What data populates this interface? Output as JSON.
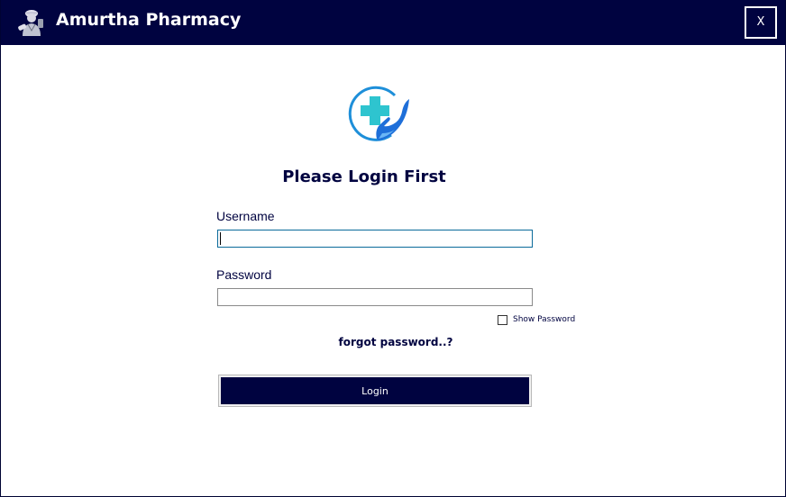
{
  "window": {
    "title": "Amurtha Pharmacy",
    "close_label": "X"
  },
  "login": {
    "heading": "Please Login First",
    "username_label": "Username",
    "username_value": "",
    "password_label": "Password",
    "password_value": "",
    "show_password_label": "Show Password",
    "show_password_checked": false,
    "forgot_password_label": "forgot password..?",
    "login_button_label": "Login"
  },
  "colors": {
    "titlebar": "#000340",
    "accent_text": "#000340",
    "logo_cross": "#2ec4cf",
    "logo_hand": "#1e6fd9"
  },
  "icons": {
    "app_icon": "pharmacist-icon",
    "logo": "medical-cross-hand-icon",
    "close": "close-icon"
  }
}
